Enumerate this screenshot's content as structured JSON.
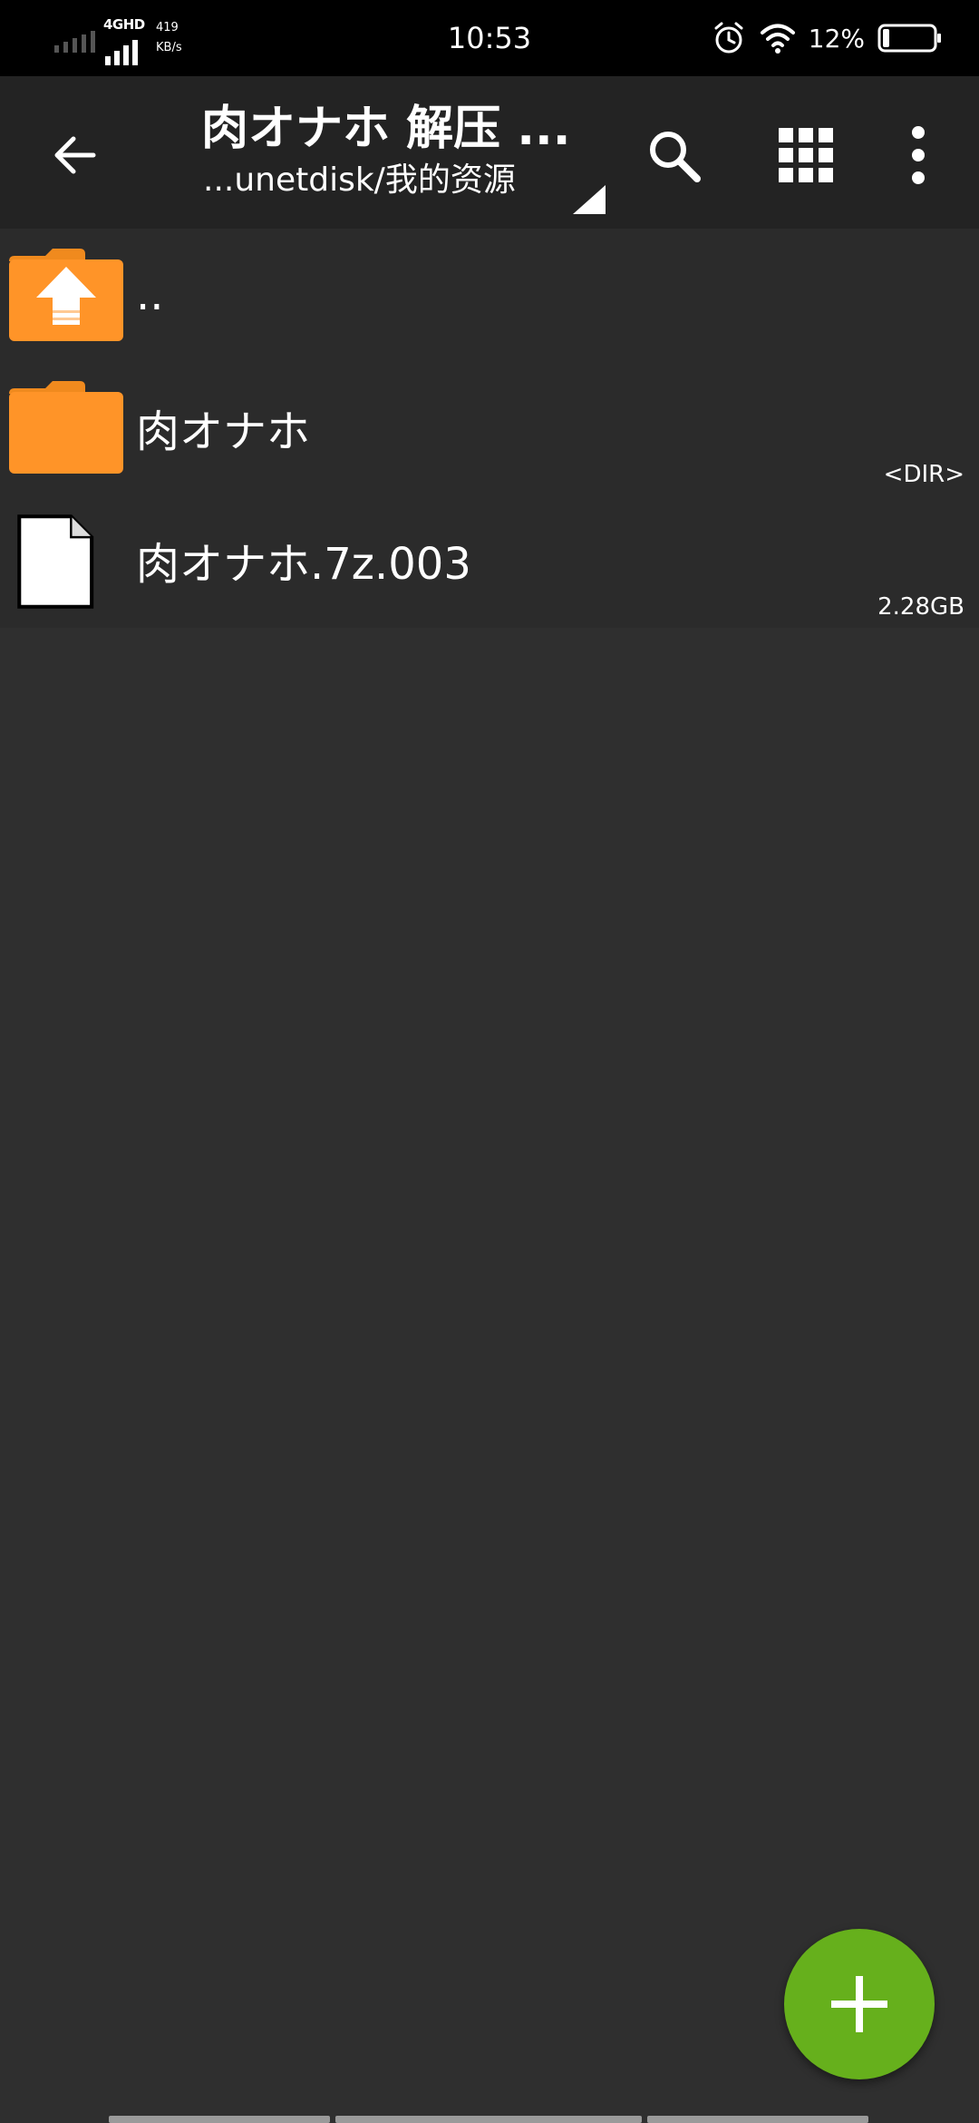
{
  "status_bar": {
    "network_type": "4GHD",
    "speed_value": "419",
    "speed_unit": "KB/s",
    "time": "10:53",
    "battery_percent": "12%"
  },
  "toolbar": {
    "title": "肉オナホ 解压 ...",
    "path": "...unetdisk/我的资源"
  },
  "files": [
    {
      "name": "..",
      "meta": "",
      "icon": "folder-up-icon"
    },
    {
      "name": "肉オナホ",
      "meta": "<DIR>",
      "icon": "folder-icon"
    },
    {
      "name": "肉オナホ.7z.003",
      "meta": "2.28GB",
      "icon": "file-icon"
    }
  ],
  "colors": {
    "background": "#2f2f2f",
    "app_bar": "#232323",
    "folder": "#ff9428",
    "fab": "#66b01c"
  },
  "icons": {
    "back": "back-arrow-icon",
    "search": "search-icon",
    "grid": "grid-view-icon",
    "more": "more-vertical-icon",
    "fab": "plus-icon"
  }
}
